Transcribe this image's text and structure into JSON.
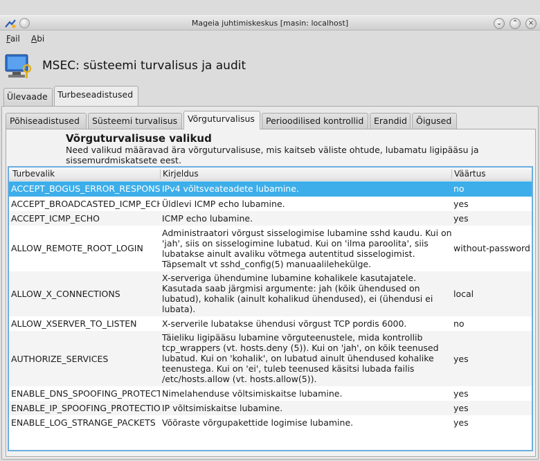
{
  "window": {
    "title": "Mageia juhtimiskeskus  [masin: localhost]"
  },
  "menu": {
    "file": {
      "accel": "F",
      "rest": "ail"
    },
    "help": {
      "accel": "A",
      "rest": "bi"
    }
  },
  "header": {
    "title": "MSEC: süsteemi turvalisus ja audit"
  },
  "outer_tabs": [
    "Ülevaade",
    "Turbeseadistused"
  ],
  "inner_tabs": [
    "Põhiseadistused",
    "Süsteemi turvalisus",
    "Võrguturvalisus",
    "Perioodilised kontrollid",
    "Erandid",
    "Õigused"
  ],
  "section": {
    "title": "Võrguturvalisuse valikud",
    "description": "Need valikud määravad ära võrguturvalisuse, mis kaitseb väliste ohtude, lubamatu ligipääsu ja sissemurdmiskatsete eest."
  },
  "table": {
    "columns": [
      "Turbevalik",
      "Kirjeldus",
      "Väärtus"
    ],
    "rows": [
      {
        "name": "ACCEPT_BOGUS_ERROR_RESPONSES",
        "desc": "IPv4 võltsveateadete lubamine.",
        "value": "no"
      },
      {
        "name": "ACCEPT_BROADCASTED_ICMP_ECHO",
        "desc": "Üldlevi ICMP echo lubamine.",
        "value": "yes"
      },
      {
        "name": "ACCEPT_ICMP_ECHO",
        "desc": "ICMP echo lubamine.",
        "value": "yes"
      },
      {
        "name": "ALLOW_REMOTE_ROOT_LOGIN",
        "desc": "Administraatori võrgust sisselogimise lubamine sshd kaudu. Kui on 'jah', siis on sisselogimine lubatud. Kui on 'ilma paroolita', siis lubatakse ainult avaliku võtmega autentitud sisselogimist. Täpsemalt vt sshd_config(5) manuaalilehekülge.",
        "value": "without-password"
      },
      {
        "name": "ALLOW_X_CONNECTIONS",
        "desc": "X-serveriga ühendumine lubamine kohalikele kasutajatele. Kasutada saab järgmisi argumente: jah (kõik ühendused on lubatud), kohalik (ainult kohalikud ühendused), ei (ühendusi ei lubata).",
        "value": "local"
      },
      {
        "name": "ALLOW_XSERVER_TO_LISTEN",
        "desc": "X-serverile lubatakse ühendusi võrgust TCP pordis 6000.",
        "value": "no"
      },
      {
        "name": "AUTHORIZE_SERVICES",
        "desc": "Täieliku ligipääsu lubamine võrguteenustele, mida kontrollib tcp_wrappers (vt. hosts.deny (5)). Kui on 'jah', on kõik teenused lubatud. Kui on 'kohalik', on lubatud ainult ühendused kohalike teenustega. Kui on 'ei', tuleb teenused käsitsi lubada failis /etc/hosts.allow (vt. hosts.allow(5)).",
        "value": "yes"
      },
      {
        "name": "ENABLE_DNS_SPOOFING_PROTECTION",
        "desc": "Nimelahenduse võltsimiskaitse lubamine.",
        "value": "yes"
      },
      {
        "name": "ENABLE_IP_SPOOFING_PROTECTION",
        "desc": "IP võltsimiskaitse lubamine.",
        "value": "yes"
      },
      {
        "name": "ENABLE_LOG_STRANGE_PACKETS",
        "desc": "Võõraste võrgupakettide logimise lubamine.",
        "value": "yes"
      }
    ]
  }
}
